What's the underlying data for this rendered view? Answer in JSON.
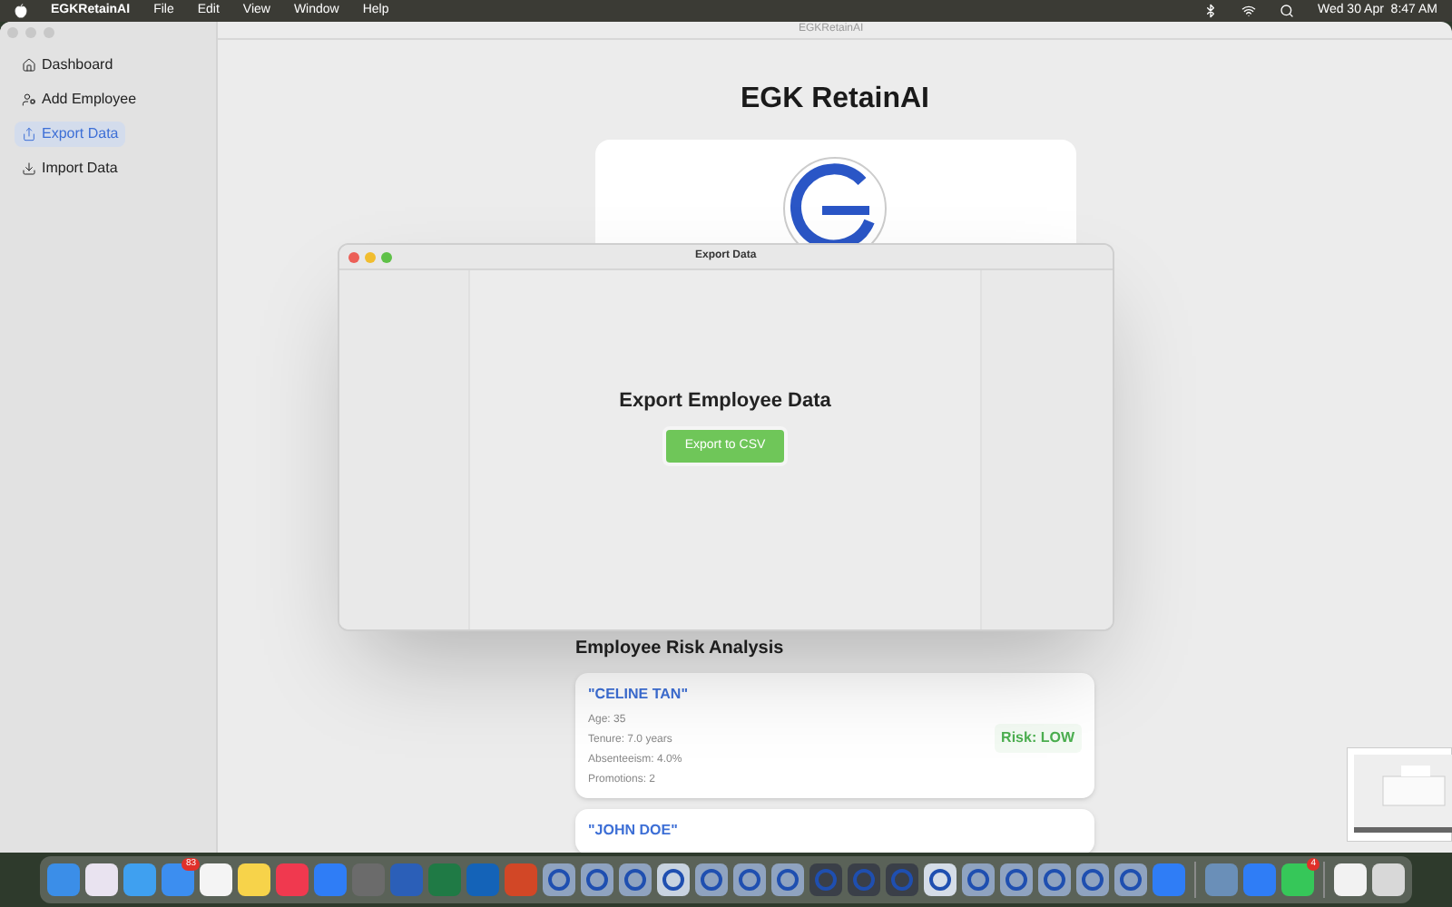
{
  "menu_bar": {
    "app_name": "EGKRetainAI",
    "menus": [
      "File",
      "Edit",
      "View",
      "Window",
      "Help"
    ],
    "clock": "Wed 30 Apr  8:47 AM"
  },
  "window": {
    "title": "EGKRetainAI"
  },
  "sidebar": {
    "items": [
      {
        "label": "Dashboard",
        "kind": "home",
        "selected": false
      },
      {
        "label": "Add Employee",
        "kind": "person",
        "selected": false
      },
      {
        "label": "Export Data",
        "kind": "export",
        "selected": true
      },
      {
        "label": "Import Data",
        "kind": "import",
        "selected": false
      }
    ]
  },
  "main": {
    "title": "EGK RetainAI",
    "section_title": "Employee Risk Analysis",
    "employees": [
      {
        "name": "\"CELINE TAN\"",
        "details": [
          "Age: 35",
          "Tenure: 7.0 years",
          "Absenteeism: 4.0%",
          "Promotions: 2"
        ],
        "risk": "Risk: LOW",
        "color": "#4caf50"
      },
      {
        "name": "\"JOHN DOE\""
      }
    ]
  },
  "sheet": {
    "title": "Export Data",
    "heading": "Export Employee Data",
    "button": "Export to CSV"
  },
  "dock": [
    {
      "kind": "app",
      "color": "#3b8ee8"
    },
    {
      "kind": "app",
      "color": "#e9e3f0"
    },
    {
      "kind": "app",
      "color": "#3fa0f0"
    },
    {
      "kind": "app",
      "color": "#3c8ef0",
      "badge": "83"
    },
    {
      "kind": "app",
      "color": "#f4f4f4"
    },
    {
      "kind": "app",
      "color": "#f7d34a"
    },
    {
      "kind": "app",
      "color": "#f0394f"
    },
    {
      "kind": "app",
      "color": "#2f7df6"
    },
    {
      "kind": "app",
      "color": "#6b6b6b"
    },
    {
      "kind": "app",
      "color": "#2b5fb8"
    },
    {
      "kind": "app",
      "color": "#1f7a45"
    },
    {
      "kind": "app",
      "color": "#1463b8"
    },
    {
      "kind": "app",
      "color": "#d24726"
    },
    {
      "kind": "logo",
      "color": "#8fa3c0"
    },
    {
      "kind": "logo",
      "color": "#8fa3c0"
    },
    {
      "kind": "logo",
      "color": "#8fa3c0"
    },
    {
      "kind": "logo",
      "color": "#c8d3e0"
    },
    {
      "kind": "logo",
      "color": "#8fa3c0"
    },
    {
      "kind": "logo",
      "color": "#8fa3c0"
    },
    {
      "kind": "logo",
      "color": "#8fa3c0"
    },
    {
      "kind": "logo",
      "color": "#3a3f48"
    },
    {
      "kind": "logo",
      "color": "#3a3f48"
    },
    {
      "kind": "logo",
      "color": "#3a3f48"
    },
    {
      "kind": "logo",
      "color": "#d5dde8"
    },
    {
      "kind": "logo",
      "color": "#8fa3c0"
    },
    {
      "kind": "logo",
      "color": "#8fa3c0"
    },
    {
      "kind": "logo",
      "color": "#8fa3c0"
    },
    {
      "kind": "logo",
      "color": "#8fa3c0"
    },
    {
      "kind": "logo",
      "color": "#8fa3c0"
    },
    {
      "kind": "app",
      "color": "#2f7df6"
    },
    {
      "kind": "separator"
    },
    {
      "kind": "app",
      "color": "#6a8fb8"
    },
    {
      "kind": "app",
      "color": "#2f7df6"
    },
    {
      "kind": "app",
      "color": "#36c759",
      "badge": "4"
    },
    {
      "kind": "separator"
    },
    {
      "kind": "app",
      "color": "#f2f2f2"
    },
    {
      "kind": "app",
      "color": "#d8d8d8"
    }
  ]
}
